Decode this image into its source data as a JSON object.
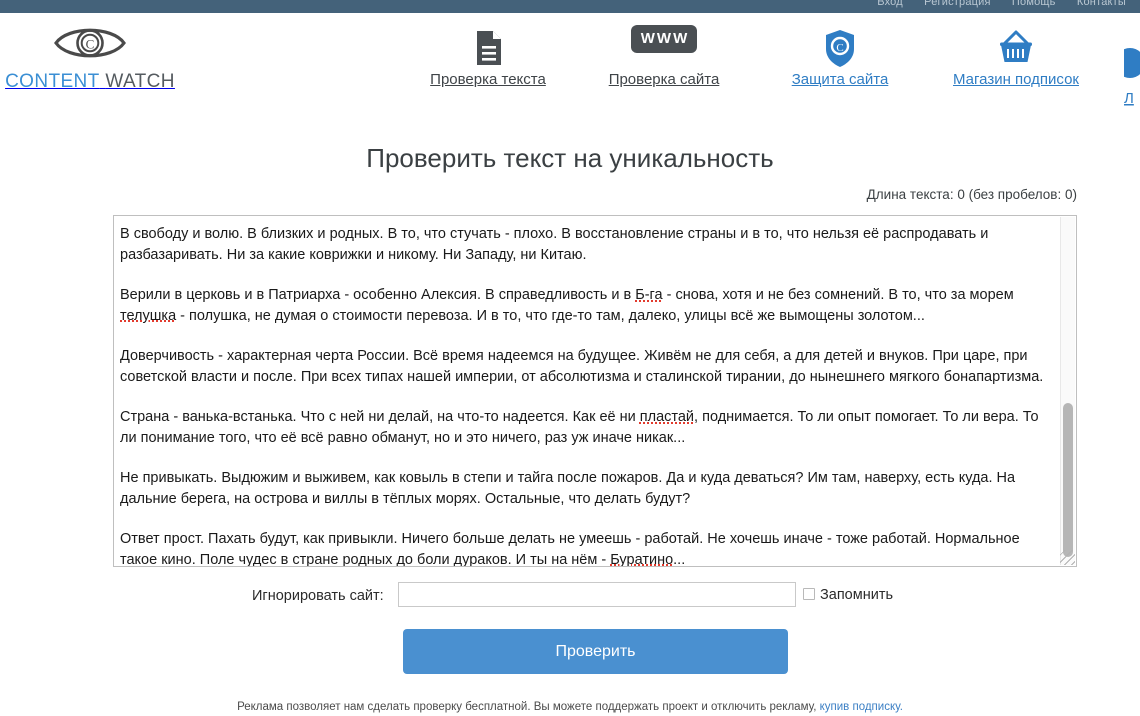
{
  "topbar": {
    "links": [
      "Вход",
      "Регистрация",
      "Помощь",
      "Контакты"
    ]
  },
  "logo": {
    "icon": "eye-copyright-icon",
    "text_primary": "CONTENT",
    "text_secondary": "WATCH"
  },
  "nav": {
    "items": [
      {
        "label": "Проверка текста",
        "icon": "document-icon",
        "style": "dark"
      },
      {
        "label": "Проверка сайта",
        "icon": "www-badge-icon",
        "style": "dark"
      },
      {
        "label": "Защита сайта",
        "icon": "shield-copyright-icon",
        "style": "blue"
      },
      {
        "label": "Магазин подписок",
        "icon": "basket-icon",
        "style": "blue"
      }
    ],
    "cut_off_icon": "circle-icon"
  },
  "main": {
    "title": "Проверить текст на уникальность",
    "length_info": "Длина текста: 0 (без пробелов: 0)",
    "editor": {
      "paragraphs": [
        [
          {
            "t": "В свободу и волю. В близких и родных. В то, что стучать - плохо. В восстановление страны и в то, что нельзя её распродавать и разбазаривать. Ни за какие коврижки и никому. Ни Западу, ни Китаю."
          }
        ],
        [
          {
            "t": "Верили в церковь и в Патриарха - особенно Алексия. В справедливость и в "
          },
          {
            "t": "Б-га",
            "spell": true
          },
          {
            "t": " - снова, хотя и не без сомнений. В то, что за морем "
          },
          {
            "t": "телушка",
            "spell": true
          },
          {
            "t": " - полушка, не думая о стоимости перевоза. И в то, что где-то там, далеко, улицы всё же вымощены золотом..."
          }
        ],
        [
          {
            "t": "Доверчивость - характерная черта России. Всё время надеемся на будущее. Живём не для себя, а для детей и внуков. При царе, при советской власти и после. При всех типах нашей империи, от абсолютизма и сталинской тирании, до нынешнего мягкого бонапартизма."
          }
        ],
        [
          {
            "t": "Страна - ванька-встанька. Что с ней ни делай, на что-то надеется. Как её ни "
          },
          {
            "t": "пластай",
            "spell": true
          },
          {
            "t": ", поднимается. То ли опыт помогает. То ли вера. То ли понимание того, что её всё равно обманут, но и это ничего, раз уж иначе никак..."
          }
        ],
        [
          {
            "t": "Не привыкать. Выдюжим и выживем, как ковыль в степи и тайга после пожаров. Да и куда деваться? Им там, наверху, есть куда. На дальние берега, на острова и виллы в тёплых морях. Остальные, что делать будут?"
          }
        ],
        [
          {
            "t": "Ответ прост. Пахать будут, как привыкли. Ничего больше делать не умеешь - работай. Не хочешь иначе - тоже работай. Нормальное такое кино. Поле чудес в стране родных до боли дураков. И ты на нём - "
          },
          {
            "t": "Буратино",
            "spell": true
          },
          {
            "t": "..."
          }
        ]
      ]
    },
    "ignore_site": {
      "label": "Игнорировать сайт:",
      "value": "",
      "placeholder": "",
      "remember_label": "Запомнить",
      "remember_checked": false
    },
    "submit_label": "Проверить"
  },
  "footer": {
    "text": "Реклама позволяет нам сделать проверку бесплатной. Вы можете поддержать проект и отключить рекламу, ",
    "link": "купив подписку."
  },
  "colors": {
    "topbar": "#44627a",
    "accent_blue": "#3b8fd4",
    "button_blue": "#4a90d0",
    "icon_dark": "#4a4f53",
    "spell_red": "#e23b2e"
  }
}
